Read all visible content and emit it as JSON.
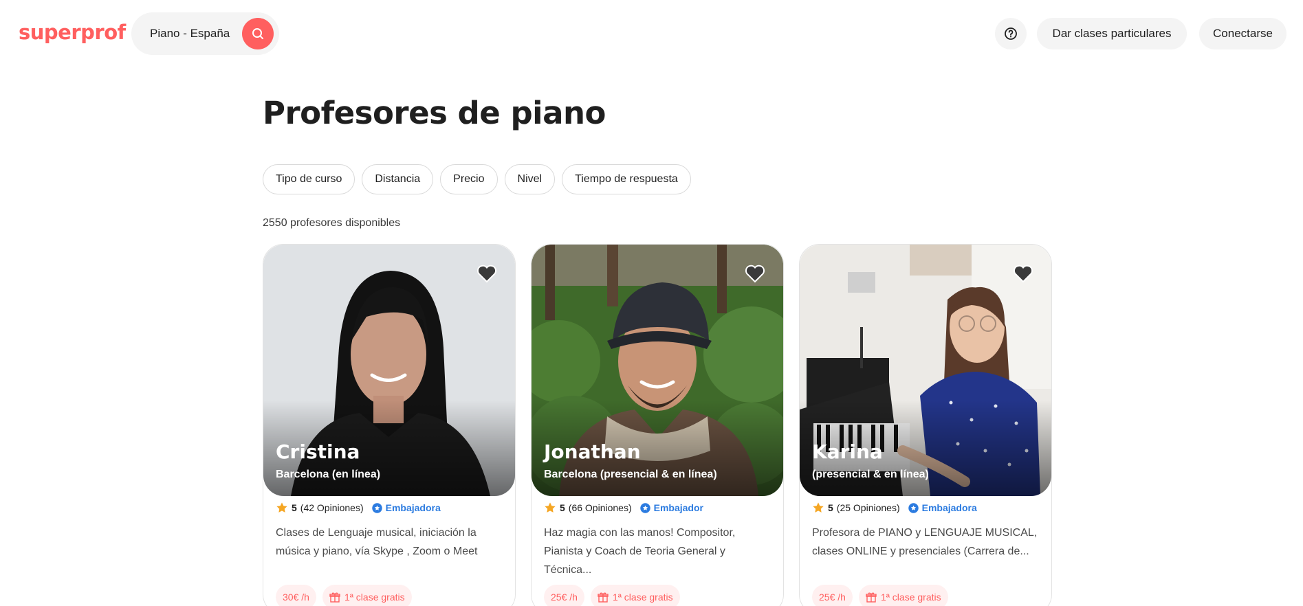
{
  "header": {
    "logo": "superprof",
    "search_value": "Piano - España",
    "help_icon": "question-circle-icon",
    "teach_label": "Dar clases particulares",
    "login_label": "Conectarse"
  },
  "colors": {
    "brand": "#ff5f5f",
    "ambassador": "#2b7be0",
    "star": "#f5a623"
  },
  "main": {
    "title": "Profesores de piano",
    "filters": [
      "Tipo de curso",
      "Distancia",
      "Precio",
      "Nivel",
      "Tiempo de respuesta"
    ],
    "count": "2550 profesores disponibles"
  },
  "tutors": [
    {
      "name": "Cristina",
      "location": "Barcelona (en línea)",
      "rating": "5",
      "reviews": "(42 Opiniones)",
      "badge": "Embajadora",
      "description": "Clases de Lenguaje musical, iniciación la música y piano, vía Skype , Zoom o Meet",
      "price": "30€ /h",
      "free": "1ª clase gratis"
    },
    {
      "name": "Jonathan",
      "location": "Barcelona (presencial & en línea)",
      "rating": "5",
      "reviews": "(66 Opiniones)",
      "badge": "Embajador",
      "description": "Haz magia con las manos! Compositor, Pianista y Coach de Teoria General y Técnica...",
      "price": "25€ /h",
      "free": "1ª clase gratis"
    },
    {
      "name": "Karina",
      "location": "(presencial & en línea)",
      "rating": "5",
      "reviews": "(25 Opiniones)",
      "badge": "Embajadora",
      "description": "Profesora de PIANO y LENGUAJE MUSICAL, clases ONLINE y presenciales (Carrera de...",
      "price": "25€ /h",
      "free": "1ª clase gratis"
    }
  ]
}
